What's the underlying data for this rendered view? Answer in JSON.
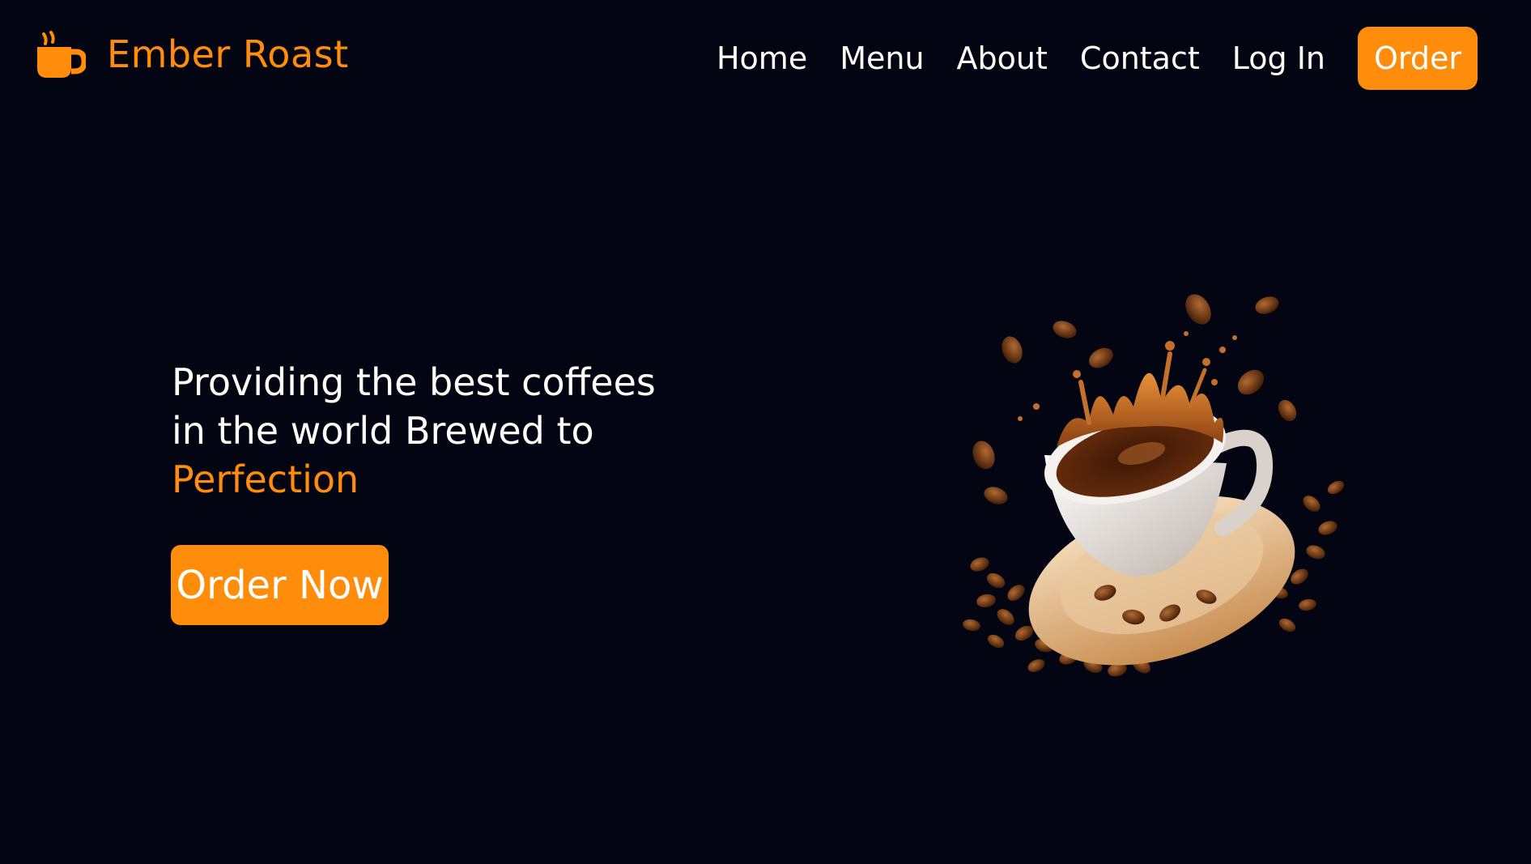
{
  "brand": {
    "name": "Ember Roast",
    "icon": "coffee-cup-icon",
    "color": "#ff8c0a"
  },
  "nav": {
    "items": [
      {
        "label": "Home"
      },
      {
        "label": "Menu"
      },
      {
        "label": "About"
      },
      {
        "label": "Contact"
      },
      {
        "label": "Log In"
      }
    ],
    "order_label": "Order"
  },
  "hero": {
    "headline_line1": "Providing the best coffees",
    "headline_line2": "in the world Brewed to",
    "headline_accent": "Perfection",
    "cta_label": "Order Now",
    "image": "coffee-cup-splash-with-beans"
  },
  "colors": {
    "background": "#030612",
    "accent": "#ff8c0a",
    "text": "#ffffff"
  }
}
